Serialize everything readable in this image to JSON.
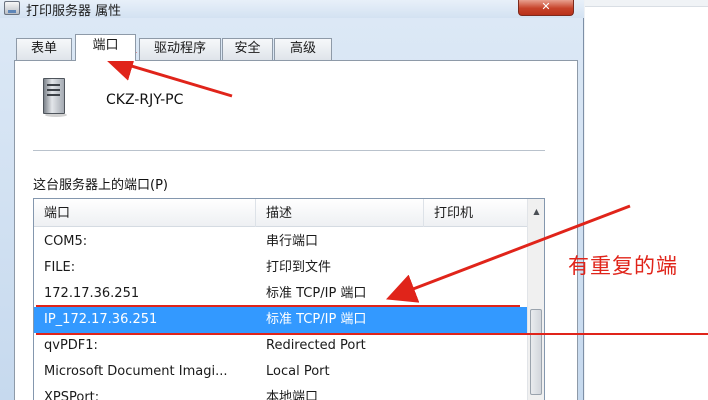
{
  "window": {
    "title": "打印服务器 属性",
    "close_glyph": "✕"
  },
  "tabs": [
    {
      "label": "表单"
    },
    {
      "label": "端口"
    },
    {
      "label": "驱动程序"
    },
    {
      "label": "安全"
    },
    {
      "label": "高级"
    }
  ],
  "active_tab": "端口",
  "server": {
    "name": "CKZ-RJY-PC"
  },
  "ports_section": {
    "label": "这台服务器上的端口(P)"
  },
  "list": {
    "columns": [
      "端口",
      "描述",
      "打印机"
    ],
    "rows": [
      {
        "port": "COM5:",
        "description": "串行端口",
        "printer": ""
      },
      {
        "port": "FILE:",
        "description": "打印到文件",
        "printer": ""
      },
      {
        "port": "172.17.36.251",
        "description": "标准 TCP/IP 端口",
        "printer": ""
      },
      {
        "port": "IP_172.17.36.251",
        "description": "标准 TCP/IP 端口",
        "printer": "",
        "selected": true
      },
      {
        "port": "qvPDF1:",
        "description": "Redirected Port",
        "printer": ""
      },
      {
        "port": "Microsoft Document Imagi...",
        "description": "Local Port",
        "printer": ""
      },
      {
        "port": "XPSPort:",
        "description": "本地端口",
        "printer": ""
      }
    ],
    "scroll_up_glyph": "▲"
  },
  "annotation": {
    "text": "有重复的端",
    "color": "#e0241a"
  },
  "colors": {
    "selection": "#3399ff",
    "annotation": "#e0241a",
    "tab_border": "#8e9aa8"
  }
}
